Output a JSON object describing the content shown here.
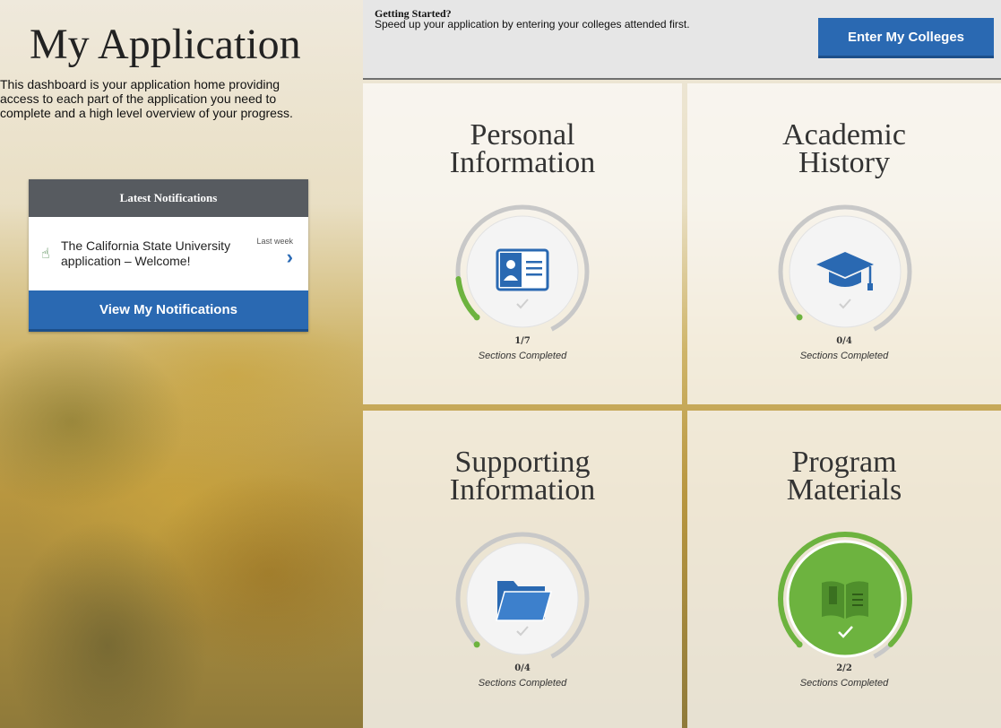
{
  "left": {
    "title": "My Application",
    "description": "This dashboard is your application home providing access to each part of the application you need to complete and a high level overview of your progress.",
    "notifications": {
      "header": "Latest Notifications",
      "item_text": "The California State University application – Welcome!",
      "item_time": "Last week",
      "button": "View My Notifications"
    }
  },
  "topbar": {
    "title": "Getting Started?",
    "text": "Speed up your application by entering your colleges attended first.",
    "button": "Enter My Colleges"
  },
  "tiles": [
    {
      "title_line1": "Personal",
      "title_line2": "Information",
      "count": "1/7",
      "status": "Sections Completed",
      "progress": 0.142857,
      "icon": "id-card-icon",
      "complete": false
    },
    {
      "title_line1": "Academic",
      "title_line2": "History",
      "count": "0/4",
      "status": "Sections Completed",
      "progress": 0,
      "icon": "graduation-cap-icon",
      "complete": false
    },
    {
      "title_line1": "Supporting",
      "title_line2": "Information",
      "count": "0/4",
      "status": "Sections Completed",
      "progress": 0,
      "icon": "folder-icon",
      "complete": false
    },
    {
      "title_line1": "Program",
      "title_line2": "Materials",
      "count": "2/2",
      "status": "Sections Completed",
      "progress": 1,
      "icon": "book-icon",
      "complete": true
    }
  ],
  "colors": {
    "primary_blue": "#2a69b2",
    "progress_green": "#6db33f",
    "ring_gray": "#c8c8c8",
    "header_gray": "#575b60"
  }
}
